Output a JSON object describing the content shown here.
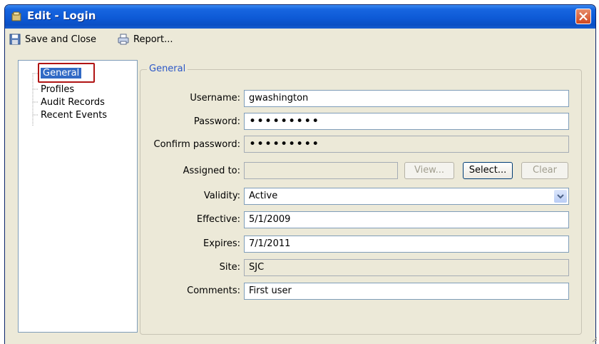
{
  "window": {
    "title": "Edit - Login"
  },
  "toolbar": {
    "save_close": "Save and Close",
    "report": "Report..."
  },
  "tree": {
    "items": [
      "General",
      "Profiles",
      "Audit Records",
      "Recent Events"
    ]
  },
  "group": {
    "title": "General"
  },
  "form": {
    "username": {
      "label": "Username:",
      "value": "gwashington"
    },
    "password": {
      "label": "Password:",
      "value": "•••••••••"
    },
    "confirm_password": {
      "label": "Confirm password:",
      "value": "•••••••••"
    },
    "assigned_to": {
      "label": "Assigned to:",
      "value": "",
      "view_btn": "View...",
      "select_btn": "Select...",
      "clear_btn": "Clear"
    },
    "validity": {
      "label": "Validity:",
      "value": "Active"
    },
    "effective": {
      "label": "Effective:",
      "value": "5/1/2009"
    },
    "expires": {
      "label": "Expires:",
      "value": "7/1/2011"
    },
    "site": {
      "label": "Site:",
      "value": "SJC"
    },
    "comments": {
      "label": "Comments:",
      "value": "First user"
    }
  },
  "colors": {
    "title_bar": "#0e5ad6",
    "selection": "#316ac5",
    "group_title": "#2b57c7",
    "highlight": "#b01414"
  }
}
